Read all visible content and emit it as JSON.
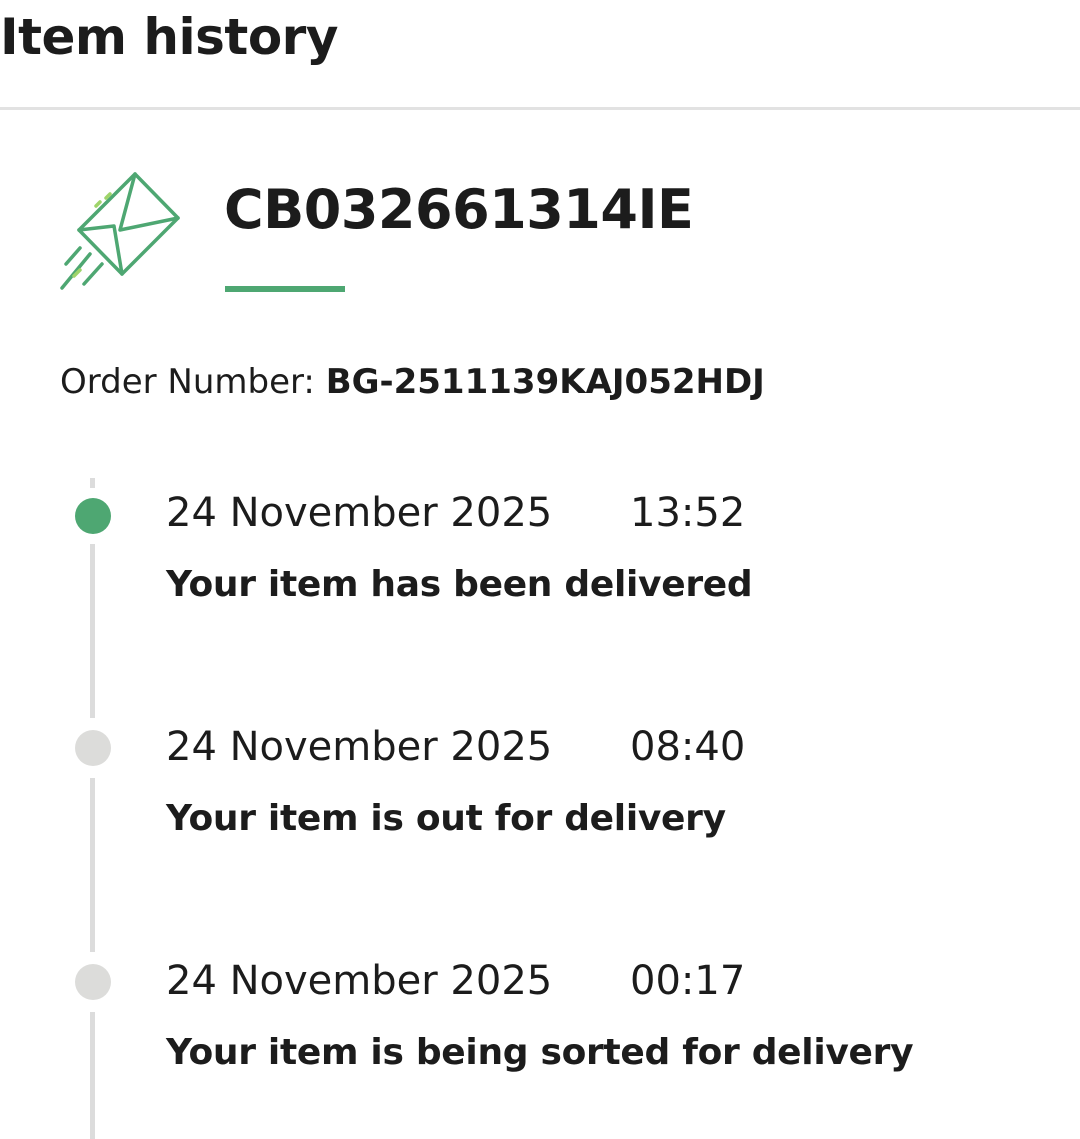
{
  "header": {
    "title": "Item history"
  },
  "item": {
    "icon": "envelope-icon",
    "tracking_number": "CB032661314IE",
    "order_label": "Order Number:",
    "order_number": "BG-2511139KAJ052HDJ"
  },
  "colors": {
    "accent": "#4ea772",
    "inactive_dot": "#dcdcda",
    "timeline": "#dcdcdc",
    "divider": "#e2e2e2"
  },
  "events": [
    {
      "date": "24 November 2025",
      "time": "13:52",
      "status": "Your item has been delivered",
      "active": true
    },
    {
      "date": "24 November 2025",
      "time": "08:40",
      "status": "Your item is out for delivery",
      "active": false
    },
    {
      "date": "24 November 2025",
      "time": "00:17",
      "status": "Your item is being sorted for delivery",
      "active": false
    }
  ]
}
